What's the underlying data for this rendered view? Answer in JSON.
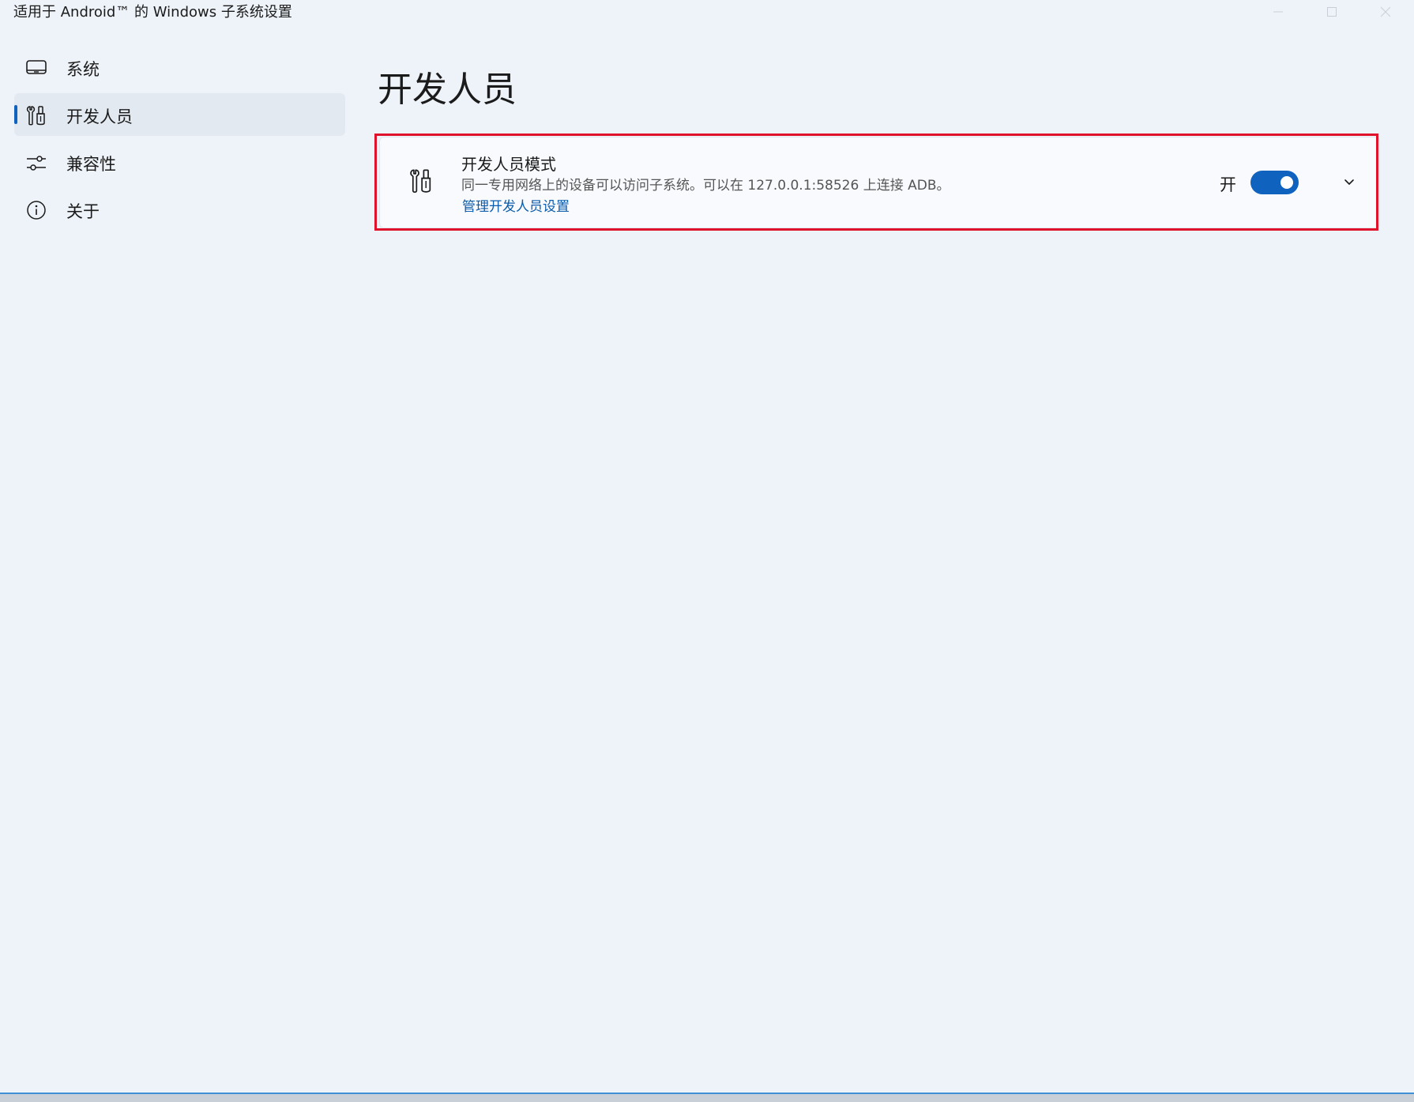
{
  "window": {
    "title": "适用于 Android™ 的 Windows 子系统设置"
  },
  "sidebar": {
    "items": [
      {
        "label": "系统",
        "icon": "system-icon",
        "active": false
      },
      {
        "label": "开发人员",
        "icon": "developer-tools-icon",
        "active": true
      },
      {
        "label": "兼容性",
        "icon": "sliders-icon",
        "active": false
      },
      {
        "label": "关于",
        "icon": "info-icon",
        "active": false
      }
    ]
  },
  "main": {
    "page_title": "开发人员",
    "developer_mode_card": {
      "icon": "developer-tools-icon",
      "title": "开发人员模式",
      "description": "同一专用网络上的设备可以访问子系统。可以在 127.0.0.1:58526 上连接 ADB。",
      "link": "管理开发人员设置",
      "toggle_state_label": "开",
      "toggle_on": true
    }
  },
  "colors": {
    "accent": "#0f62bd",
    "highlight": "#e0112b",
    "background": "#eef3f9"
  }
}
